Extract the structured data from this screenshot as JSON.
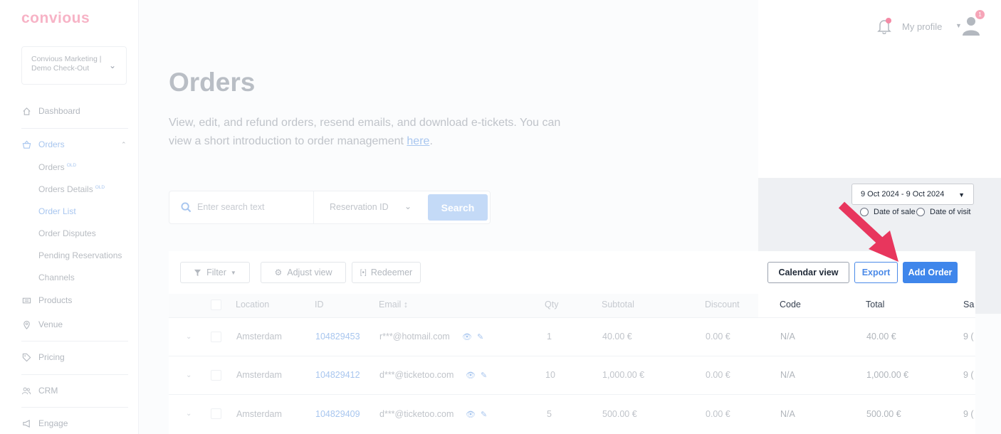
{
  "brand": {
    "logo": "convious"
  },
  "sidebar": {
    "account": {
      "line1": "Convious Marketing |",
      "line2": "Demo Check-Out"
    },
    "items": [
      {
        "label": "Dashboard",
        "icon": "home-icon"
      },
      {
        "label": "Orders",
        "icon": "basket-icon",
        "active": true
      },
      {
        "label": "Products",
        "icon": "ticket-icon"
      },
      {
        "label": "Venue",
        "icon": "location-pin-icon"
      },
      {
        "label": "Pricing",
        "icon": "tag-icon"
      },
      {
        "label": "CRM",
        "icon": "users-icon"
      },
      {
        "label": "Engage",
        "icon": "megaphone-icon"
      }
    ],
    "orders_sub": [
      {
        "label": "Orders",
        "badge": "OLD"
      },
      {
        "label": "Orders Details",
        "badge": "OLD"
      },
      {
        "label": "Order List",
        "active": true
      },
      {
        "label": "Order Disputes"
      },
      {
        "label": "Pending Reservations"
      },
      {
        "label": "Channels"
      }
    ]
  },
  "header": {
    "profile_label": "My profile",
    "notification_count": "1"
  },
  "page": {
    "title": "Orders",
    "desc_text": "View, edit, and refund orders, resend emails, and download e-tickets. You can view a short introduction to order management ",
    "desc_link": "here",
    "desc_end": "."
  },
  "search": {
    "placeholder": "Enter search text",
    "field": "Reservation ID",
    "button": "Search"
  },
  "date_filter": {
    "range": "9 Oct 2024 - 9 Oct 2024",
    "option_sale": "Date of sale",
    "option_visit": "Date of visit"
  },
  "toolbar": {
    "filter": "Filter",
    "adjust": "Adjust view",
    "redeemer": "Redeemer",
    "calendar": "Calendar view",
    "export": "Export",
    "add": "Add Order"
  },
  "table": {
    "columns": [
      "Location",
      "ID",
      "Email ↕",
      "Qty",
      "Subtotal",
      "Discount",
      "Code",
      "Total",
      "Sa"
    ],
    "rows": [
      {
        "location": "Amsterdam",
        "id": "104829453",
        "email": "r***@hotmail.com",
        "qty": "1",
        "subtotal": "40.00 €",
        "discount": "0.00 €",
        "code": "N/A",
        "total": "40.00 €",
        "sa": "9 ("
      },
      {
        "location": "Amsterdam",
        "id": "104829412",
        "email": "d***@ticketoo.com",
        "qty": "10",
        "subtotal": "1,000.00 €",
        "discount": "0.00 €",
        "code": "N/A",
        "total": "1,000.00 €",
        "sa": "9 ("
      },
      {
        "location": "Amsterdam",
        "id": "104829409",
        "email": "d***@ticketoo.com",
        "qty": "5",
        "subtotal": "500.00 €",
        "discount": "0.00 €",
        "code": "N/A",
        "total": "500.00 €",
        "sa": "9 ("
      }
    ]
  },
  "colors": {
    "accent": "#3f86eb",
    "brand": "#f7b3c6",
    "arrow": "#e8365d"
  }
}
